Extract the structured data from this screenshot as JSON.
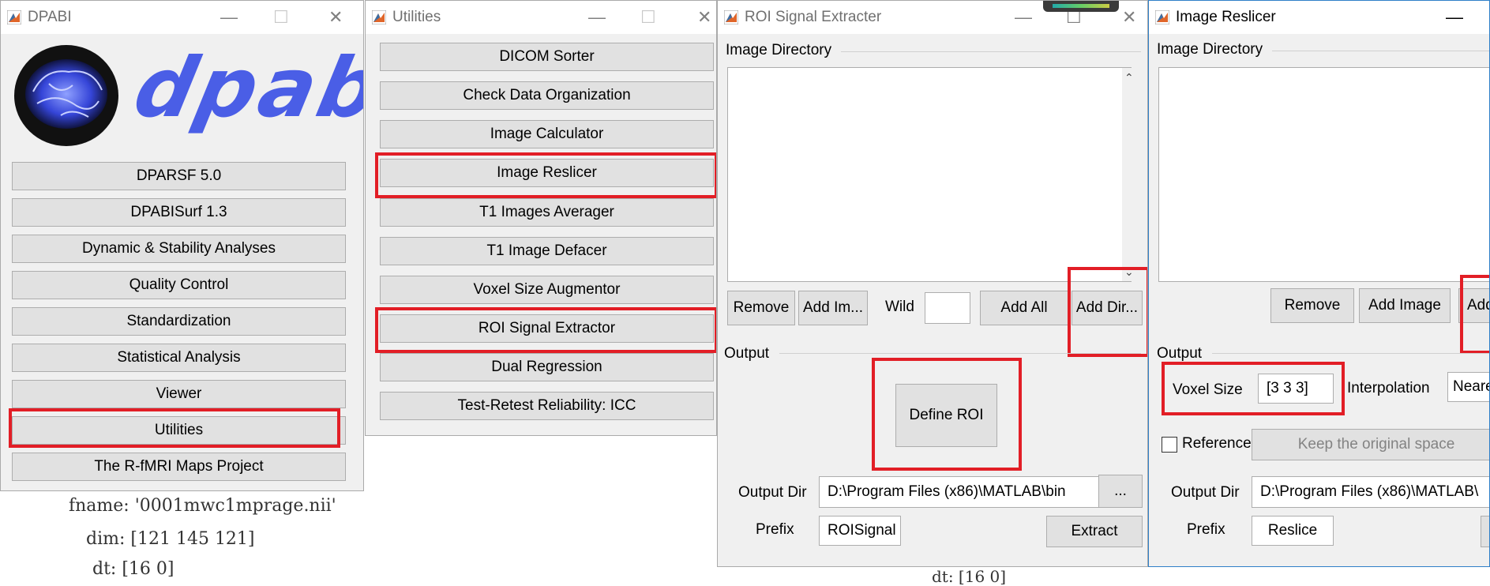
{
  "dpabi": {
    "title": "DPABI",
    "logo_text": "dpabi",
    "buttons": [
      "DPARSF 5.0",
      "DPABISurf 1.3",
      "Dynamic & Stability Analyses",
      "Quality Control",
      "Standardization",
      "Statistical Analysis",
      "Viewer",
      "Utilities",
      "The R-fMRI Maps Project"
    ]
  },
  "utilities": {
    "title": "Utilities",
    "buttons": [
      "DICOM Sorter",
      "Check Data Organization",
      "Image Calculator",
      "Image Reslicer",
      "T1 Images Averager",
      "T1 Image Defacer",
      "Voxel Size Augmentor",
      "ROI Signal Extractor",
      "Dual Regression",
      "Test-Retest Reliability: ICC"
    ]
  },
  "roi_extractor": {
    "title": "ROI Signal Extracter",
    "image_directory_label": "Image Directory",
    "remove_label": "Remove",
    "add_image_label": "Add Im...",
    "wild_label": "Wild",
    "wild_value": "",
    "add_all_label": "Add All",
    "add_dir_label": "Add Dir...",
    "output_label": "Output",
    "define_roi_label": "Define ROI",
    "output_dir_label": "Output Dir",
    "output_dir_value": "D:\\Program Files (x86)\\MATLAB\\bin",
    "browse_label": "...",
    "prefix_label": "Prefix",
    "prefix_value": "ROISignal",
    "extract_label": "Extract"
  },
  "reslicer": {
    "title": "Image Reslicer",
    "image_directory_label": "Image Directory",
    "remove_label": "Remove",
    "add_image_label": "Add Image",
    "add_dir_label": "Add",
    "output_label": "Output",
    "voxel_size_label": "Voxel Size",
    "voxel_size_value": "[3 3 3]",
    "interpolation_label": "Interpolation",
    "interpolation_value": "Neare",
    "reference_label": "Reference",
    "keep_space_label": "Keep the original space",
    "output_dir_label": "Output Dir",
    "output_dir_value": "D:\\Program Files (x86)\\MATLAB\\",
    "prefix_label": "Prefix",
    "prefix_value": "Reslice"
  },
  "background_code": {
    "line1": "fname: '0001mwc1mprage.nii'",
    "line2": "dim: [121 145 121]",
    "line3": "dt: [16 0]",
    "line4": "dt: [16 0]"
  },
  "colors": {
    "highlight": "#e21e26",
    "logo": "#4a5ee6"
  }
}
